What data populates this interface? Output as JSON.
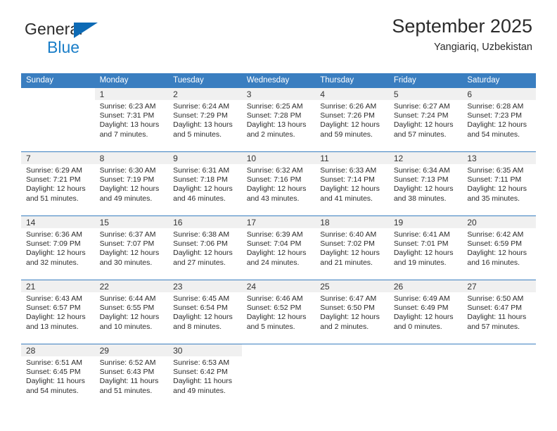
{
  "brand": {
    "line1": "General",
    "line2": "Blue",
    "accent_color": "#0d6ab5",
    "text_color": "#1a7ec8"
  },
  "header": {
    "title": "September 2025",
    "location": "Yangiariq, Uzbekistan"
  },
  "theme": {
    "header_blue": "#3a7ec0",
    "daynum_band": "#f0f0f0",
    "page_background": "#ffffff"
  },
  "calendar": {
    "weekday_headers": [
      "Sunday",
      "Monday",
      "Tuesday",
      "Wednesday",
      "Thursday",
      "Friday",
      "Saturday"
    ],
    "weeks": [
      [
        {
          "day": "",
          "blank": true,
          "sunrise": "",
          "sunset": "",
          "daylight_line1": "",
          "daylight_line2": ""
        },
        {
          "day": "1",
          "blank": false,
          "sunrise": "Sunrise: 6:23 AM",
          "sunset": "Sunset: 7:31 PM",
          "daylight_line1": "Daylight: 13 hours",
          "daylight_line2": "and 7 minutes."
        },
        {
          "day": "2",
          "blank": false,
          "sunrise": "Sunrise: 6:24 AM",
          "sunset": "Sunset: 7:29 PM",
          "daylight_line1": "Daylight: 13 hours",
          "daylight_line2": "and 5 minutes."
        },
        {
          "day": "3",
          "blank": false,
          "sunrise": "Sunrise: 6:25 AM",
          "sunset": "Sunset: 7:28 PM",
          "daylight_line1": "Daylight: 13 hours",
          "daylight_line2": "and 2 minutes."
        },
        {
          "day": "4",
          "blank": false,
          "sunrise": "Sunrise: 6:26 AM",
          "sunset": "Sunset: 7:26 PM",
          "daylight_line1": "Daylight: 12 hours",
          "daylight_line2": "and 59 minutes."
        },
        {
          "day": "5",
          "blank": false,
          "sunrise": "Sunrise: 6:27 AM",
          "sunset": "Sunset: 7:24 PM",
          "daylight_line1": "Daylight: 12 hours",
          "daylight_line2": "and 57 minutes."
        },
        {
          "day": "6",
          "blank": false,
          "sunrise": "Sunrise: 6:28 AM",
          "sunset": "Sunset: 7:23 PM",
          "daylight_line1": "Daylight: 12 hours",
          "daylight_line2": "and 54 minutes."
        }
      ],
      [
        {
          "day": "7",
          "blank": false,
          "sunrise": "Sunrise: 6:29 AM",
          "sunset": "Sunset: 7:21 PM",
          "daylight_line1": "Daylight: 12 hours",
          "daylight_line2": "and 51 minutes."
        },
        {
          "day": "8",
          "blank": false,
          "sunrise": "Sunrise: 6:30 AM",
          "sunset": "Sunset: 7:19 PM",
          "daylight_line1": "Daylight: 12 hours",
          "daylight_line2": "and 49 minutes."
        },
        {
          "day": "9",
          "blank": false,
          "sunrise": "Sunrise: 6:31 AM",
          "sunset": "Sunset: 7:18 PM",
          "daylight_line1": "Daylight: 12 hours",
          "daylight_line2": "and 46 minutes."
        },
        {
          "day": "10",
          "blank": false,
          "sunrise": "Sunrise: 6:32 AM",
          "sunset": "Sunset: 7:16 PM",
          "daylight_line1": "Daylight: 12 hours",
          "daylight_line2": "and 43 minutes."
        },
        {
          "day": "11",
          "blank": false,
          "sunrise": "Sunrise: 6:33 AM",
          "sunset": "Sunset: 7:14 PM",
          "daylight_line1": "Daylight: 12 hours",
          "daylight_line2": "and 41 minutes."
        },
        {
          "day": "12",
          "blank": false,
          "sunrise": "Sunrise: 6:34 AM",
          "sunset": "Sunset: 7:13 PM",
          "daylight_line1": "Daylight: 12 hours",
          "daylight_line2": "and 38 minutes."
        },
        {
          "day": "13",
          "blank": false,
          "sunrise": "Sunrise: 6:35 AM",
          "sunset": "Sunset: 7:11 PM",
          "daylight_line1": "Daylight: 12 hours",
          "daylight_line2": "and 35 minutes."
        }
      ],
      [
        {
          "day": "14",
          "blank": false,
          "sunrise": "Sunrise: 6:36 AM",
          "sunset": "Sunset: 7:09 PM",
          "daylight_line1": "Daylight: 12 hours",
          "daylight_line2": "and 32 minutes."
        },
        {
          "day": "15",
          "blank": false,
          "sunrise": "Sunrise: 6:37 AM",
          "sunset": "Sunset: 7:07 PM",
          "daylight_line1": "Daylight: 12 hours",
          "daylight_line2": "and 30 minutes."
        },
        {
          "day": "16",
          "blank": false,
          "sunrise": "Sunrise: 6:38 AM",
          "sunset": "Sunset: 7:06 PM",
          "daylight_line1": "Daylight: 12 hours",
          "daylight_line2": "and 27 minutes."
        },
        {
          "day": "17",
          "blank": false,
          "sunrise": "Sunrise: 6:39 AM",
          "sunset": "Sunset: 7:04 PM",
          "daylight_line1": "Daylight: 12 hours",
          "daylight_line2": "and 24 minutes."
        },
        {
          "day": "18",
          "blank": false,
          "sunrise": "Sunrise: 6:40 AM",
          "sunset": "Sunset: 7:02 PM",
          "daylight_line1": "Daylight: 12 hours",
          "daylight_line2": "and 21 minutes."
        },
        {
          "day": "19",
          "blank": false,
          "sunrise": "Sunrise: 6:41 AM",
          "sunset": "Sunset: 7:01 PM",
          "daylight_line1": "Daylight: 12 hours",
          "daylight_line2": "and 19 minutes."
        },
        {
          "day": "20",
          "blank": false,
          "sunrise": "Sunrise: 6:42 AM",
          "sunset": "Sunset: 6:59 PM",
          "daylight_line1": "Daylight: 12 hours",
          "daylight_line2": "and 16 minutes."
        }
      ],
      [
        {
          "day": "21",
          "blank": false,
          "sunrise": "Sunrise: 6:43 AM",
          "sunset": "Sunset: 6:57 PM",
          "daylight_line1": "Daylight: 12 hours",
          "daylight_line2": "and 13 minutes."
        },
        {
          "day": "22",
          "blank": false,
          "sunrise": "Sunrise: 6:44 AM",
          "sunset": "Sunset: 6:55 PM",
          "daylight_line1": "Daylight: 12 hours",
          "daylight_line2": "and 10 minutes."
        },
        {
          "day": "23",
          "blank": false,
          "sunrise": "Sunrise: 6:45 AM",
          "sunset": "Sunset: 6:54 PM",
          "daylight_line1": "Daylight: 12 hours",
          "daylight_line2": "and 8 minutes."
        },
        {
          "day": "24",
          "blank": false,
          "sunrise": "Sunrise: 6:46 AM",
          "sunset": "Sunset: 6:52 PM",
          "daylight_line1": "Daylight: 12 hours",
          "daylight_line2": "and 5 minutes."
        },
        {
          "day": "25",
          "blank": false,
          "sunrise": "Sunrise: 6:47 AM",
          "sunset": "Sunset: 6:50 PM",
          "daylight_line1": "Daylight: 12 hours",
          "daylight_line2": "and 2 minutes."
        },
        {
          "day": "26",
          "blank": false,
          "sunrise": "Sunrise: 6:49 AM",
          "sunset": "Sunset: 6:49 PM",
          "daylight_line1": "Daylight: 12 hours",
          "daylight_line2": "and 0 minutes."
        },
        {
          "day": "27",
          "blank": false,
          "sunrise": "Sunrise: 6:50 AM",
          "sunset": "Sunset: 6:47 PM",
          "daylight_line1": "Daylight: 11 hours",
          "daylight_line2": "and 57 minutes."
        }
      ],
      [
        {
          "day": "28",
          "blank": false,
          "sunrise": "Sunrise: 6:51 AM",
          "sunset": "Sunset: 6:45 PM",
          "daylight_line1": "Daylight: 11 hours",
          "daylight_line2": "and 54 minutes."
        },
        {
          "day": "29",
          "blank": false,
          "sunrise": "Sunrise: 6:52 AM",
          "sunset": "Sunset: 6:43 PM",
          "daylight_line1": "Daylight: 11 hours",
          "daylight_line2": "and 51 minutes."
        },
        {
          "day": "30",
          "blank": false,
          "sunrise": "Sunrise: 6:53 AM",
          "sunset": "Sunset: 6:42 PM",
          "daylight_line1": "Daylight: 11 hours",
          "daylight_line2": "and 49 minutes."
        },
        {
          "day": "",
          "blank": true,
          "sunrise": "",
          "sunset": "",
          "daylight_line1": "",
          "daylight_line2": ""
        },
        {
          "day": "",
          "blank": true,
          "sunrise": "",
          "sunset": "",
          "daylight_line1": "",
          "daylight_line2": ""
        },
        {
          "day": "",
          "blank": true,
          "sunrise": "",
          "sunset": "",
          "daylight_line1": "",
          "daylight_line2": ""
        },
        {
          "day": "",
          "blank": true,
          "sunrise": "",
          "sunset": "",
          "daylight_line1": "",
          "daylight_line2": ""
        }
      ]
    ]
  }
}
